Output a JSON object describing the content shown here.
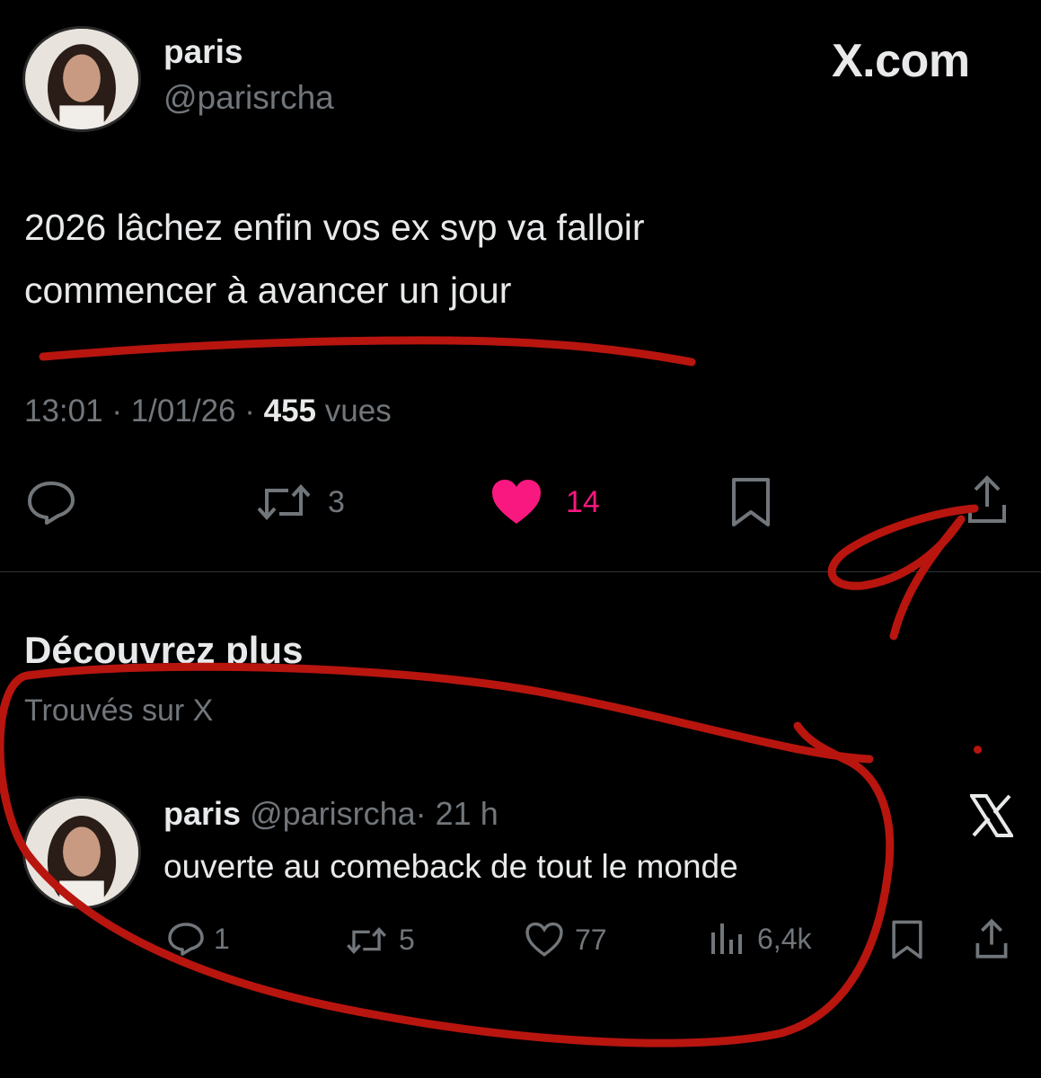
{
  "tweet": {
    "author": {
      "name": "paris",
      "handle": "@parisrcha"
    },
    "brand": "X.com",
    "text_line1": "2026 lâchez enfin vos ex svp va falloir",
    "text_line2": "commencer à avancer un jour",
    "time": "13:01",
    "date": "1/01/26",
    "separator": "·",
    "views_count": "455",
    "views_label": "vues",
    "actions": {
      "retweets": "3",
      "likes": "14",
      "liked": true
    }
  },
  "discover": {
    "title": "Découvrez plus",
    "subtitle": "Trouvés sur X",
    "post": {
      "name": "paris",
      "handle": "@parisrcha",
      "time": "· 21 h",
      "text": "ouverte au comeback de tout le monde",
      "replies": "1",
      "retweets": "5",
      "likes": "77",
      "views": "6,4k"
    }
  },
  "colors": {
    "background": "#000000",
    "text": "#e7e9ea",
    "muted": "#71767b",
    "like_pink": "#f91880",
    "annotation_red": "#b8150f"
  },
  "icons": [
    "reply-icon",
    "retweet-icon",
    "heart-icon",
    "bookmark-icon",
    "share-icon",
    "views-icon",
    "x-logo-icon"
  ]
}
